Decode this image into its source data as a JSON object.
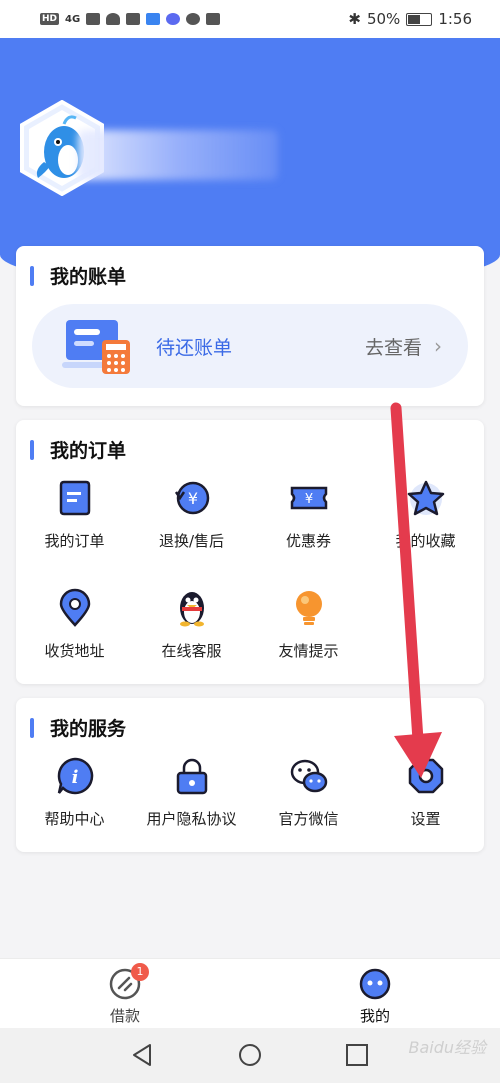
{
  "status_bar": {
    "battery": "50%",
    "time": "1:56",
    "network": "4G",
    "hd": "HD"
  },
  "bill_section": {
    "title": "我的账单",
    "item_label": "待还账单",
    "link_label": "去查看"
  },
  "order_section": {
    "title": "我的订单",
    "items": [
      {
        "label": "我的订单",
        "icon": "document-icon"
      },
      {
        "label": "退换/售后",
        "icon": "yuan-refund-icon"
      },
      {
        "label": "优惠券",
        "icon": "coupon-icon"
      },
      {
        "label": "我的收藏",
        "icon": "star-icon"
      },
      {
        "label": "收货地址",
        "icon": "location-pin-icon"
      },
      {
        "label": "在线客服",
        "icon": "penguin-icon"
      },
      {
        "label": "友情提示",
        "icon": "lightbulb-icon"
      }
    ]
  },
  "service_section": {
    "title": "我的服务",
    "items": [
      {
        "label": "帮助中心",
        "icon": "info-icon"
      },
      {
        "label": "用户隐私协议",
        "icon": "lock-icon"
      },
      {
        "label": "官方微信",
        "icon": "wechat-icon"
      },
      {
        "label": "设置",
        "icon": "settings-icon"
      }
    ]
  },
  "tabbar": {
    "tabs": [
      {
        "label": "借款",
        "badge": "1",
        "icon": "loan-icon"
      },
      {
        "label": "我的",
        "icon": "profile-icon"
      }
    ]
  },
  "watermark": "Baidu经验",
  "colors": {
    "primary": "#4f7df3",
    "arrow": "#e43b4d",
    "badge": "#f05a4a"
  }
}
